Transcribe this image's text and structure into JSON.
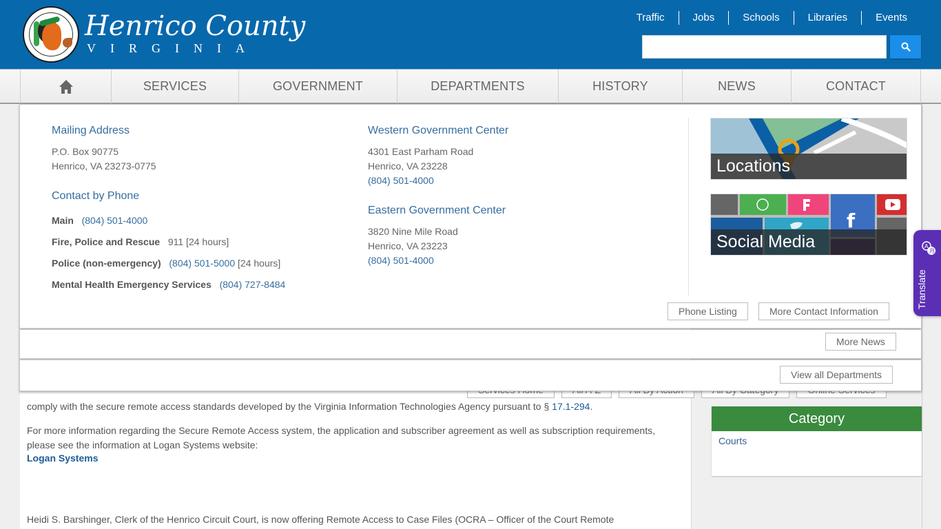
{
  "header": {
    "title": "Henrico County",
    "subtitle": "VIRGINIA",
    "seal_alt": "County of Henrico, Virginia seal",
    "top_links": [
      "Traffic",
      "Jobs",
      "Schools",
      "Libraries",
      "Events"
    ],
    "search": {
      "value": "",
      "placeholder": ""
    }
  },
  "nav": {
    "home_icon": "home-icon",
    "items": [
      "SERVICES",
      "GOVERNMENT",
      "DEPARTMENTS",
      "HISTORY",
      "NEWS",
      "CONTACT"
    ]
  },
  "contact_panel": {
    "mailing": {
      "heading": "Mailing Address",
      "line1": "P.O. Box 90775",
      "line2": "Henrico, VA 23273-0775"
    },
    "phone": {
      "heading": "Contact by Phone",
      "rows": [
        {
          "label": "Main",
          "number": "(804) 501-4000",
          "note": ""
        },
        {
          "label": "Fire, Police and Rescue",
          "number": "",
          "note": "911 [24 hours]"
        },
        {
          "label": "Police (non-emergency)",
          "number": "(804) 501-5000",
          "note": "[24 hours]"
        },
        {
          "label": "Mental Health Emergency Services",
          "number": "(804) 727-8484",
          "note": ""
        }
      ]
    },
    "western": {
      "heading": "Western Government Center",
      "line1": "4301 East Parham Road",
      "line2": "Henrico, VA 23228",
      "phone": "(804) 501-4000"
    },
    "eastern": {
      "heading": "Eastern Government Center",
      "line1": "3820 Nine Mile Road",
      "line2": "Henrico, VA 23223",
      "phone": "(804) 501-4000"
    },
    "tiles": {
      "locations": "Locations",
      "social": "Social Media"
    },
    "buttons": {
      "phone_listing": "Phone Listing",
      "more_contact": "More Contact Information"
    }
  },
  "news_panel": {
    "more_news": "More News"
  },
  "departments_panel": {
    "view_all": "View all Departments"
  },
  "page": {
    "service_buttons": [
      "Services Home",
      "All A-Z",
      "All By Action",
      "All By Category",
      "Online Services"
    ],
    "para1": "comply with the secure remote access standards developed by the Virginia Information Technologies Agency pursuant to § ",
    "para1_link": "17.1-294",
    "para2": "For more information regarding the Secure Remote Access system, the application and subscriber agreement as well as subscription requirements, please see the information at Logan Systems website:",
    "logan_link": "Logan Systems",
    "para3": "Heidi S. Barshinger, Clerk of the Henrico Circuit Court, is now offering Remote Access to Case Files (OCRA – Officer of the Court Remote",
    "category": {
      "heading": "Category",
      "link": "Courts"
    }
  },
  "translate": {
    "label": "Translate"
  },
  "colors": {
    "header_blue": "#0868ac",
    "search_button": "#1a8ee8",
    "link_blue": "#366ea0",
    "category_green": "#3a8b3e",
    "translate_purple": "#5b2fb5"
  }
}
